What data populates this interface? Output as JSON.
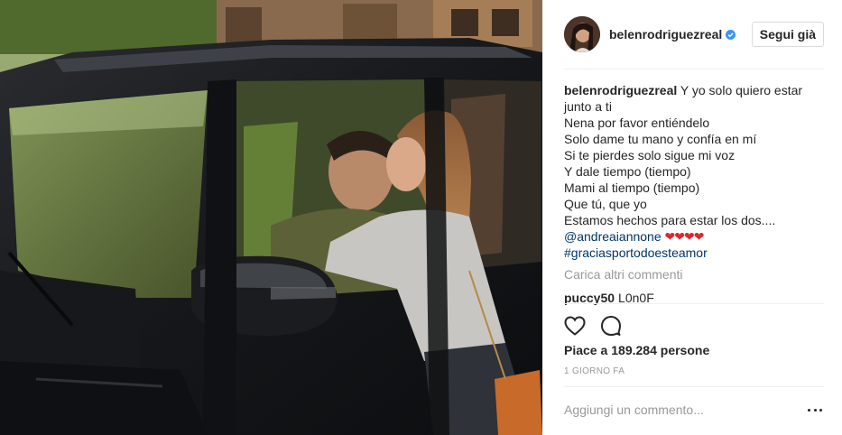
{
  "post": {
    "photo_alt": "couple kissing through car window",
    "author": {
      "username": "belenrodriguezreal",
      "verified": true,
      "avatar_icon": "profile-photo"
    },
    "follow_button_label": "Segui già",
    "caption": {
      "username": "belenrodriguezreal",
      "lines": [
        "Y yo solo quiero estar",
        "junto a ti",
        "Nena por favor entiéndelo",
        "Solo dame tu mano y confía en mí",
        "Si te pierdes solo sigue mi voz",
        "Y dale tiempo (tiempo)",
        "Mami al tiempo (tiempo)",
        "Que tú, que yo",
        "Estamos hechos para estar los dos...."
      ],
      "mention": "@andreaiannone",
      "hearts": "❤❤❤❤",
      "hashtag": "#graciasportodoesteamor"
    },
    "load_more_comments": "Carica altri commenti",
    "comments": [
      {
        "username": "puccy50",
        "text": "L0n0F"
      }
    ],
    "actions": {
      "like_icon": "heart-outline-icon",
      "comment_icon": "comment-bubble-icon"
    },
    "likes_prefix": "Piace a",
    "likes_count": "189.284 persone",
    "timestamp": "1 GIORNO FA",
    "add_comment_placeholder": "Aggiungi un commento...",
    "more_options_icon": "more-options-icon",
    "colors": {
      "link": "#003569",
      "muted": "#999999",
      "text": "#262626",
      "verified": "#3897f0",
      "hearts": "#e0262d"
    }
  }
}
